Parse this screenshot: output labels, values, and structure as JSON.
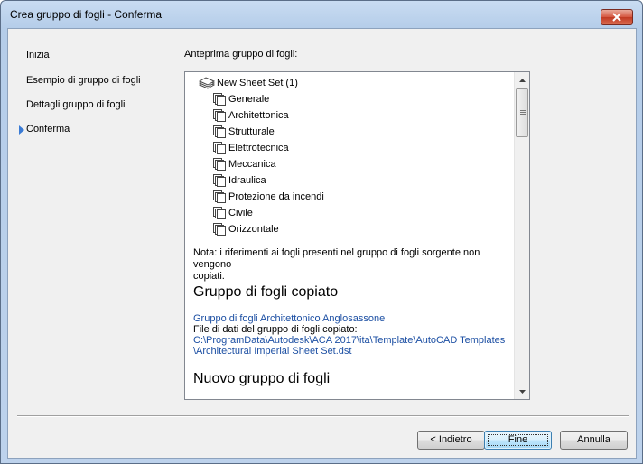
{
  "window": {
    "title": "Crea gruppo di fogli - Conferma"
  },
  "nav": {
    "items": [
      {
        "label": "Inizia"
      },
      {
        "label": "Esempio di gruppo di fogli"
      },
      {
        "label": "Dettagli gruppo di fogli"
      },
      {
        "label": "Conferma",
        "current": true
      }
    ]
  },
  "preview": {
    "label": "Anteprima gruppo di fogli:",
    "root": "New Sheet Set (1)",
    "subsets": [
      "Generale",
      "Architettonica",
      "Strutturale",
      "Elettrotecnica",
      "Meccanica",
      "Idraulica",
      "Protezione da incendi",
      "Civile",
      "Orizzontale"
    ],
    "note_line1": "Nota: i riferimenti ai fogli presenti nel gruppo di fogli sorgente non vengono",
    "note_line2": "copiati.",
    "copied_heading": "Gruppo di fogli copiato",
    "copied_link": "Gruppo di fogli Architettonico Anglosassone",
    "data_file_label": "File di dati del gruppo di fogli copiato:",
    "data_file_path_line1": "C:\\ProgramData\\Autodesk\\ACA 2017\\ita\\Template\\AutoCAD Templates",
    "data_file_path_line2": "\\Architectural Imperial Sheet Set.dst",
    "new_heading": "Nuovo gruppo di fogli"
  },
  "buttons": {
    "back": "< Indietro",
    "finish": "Fine",
    "cancel": "Annulla"
  },
  "colors": {
    "accent": "#3a7bd5",
    "link": "#1c4fa3"
  }
}
